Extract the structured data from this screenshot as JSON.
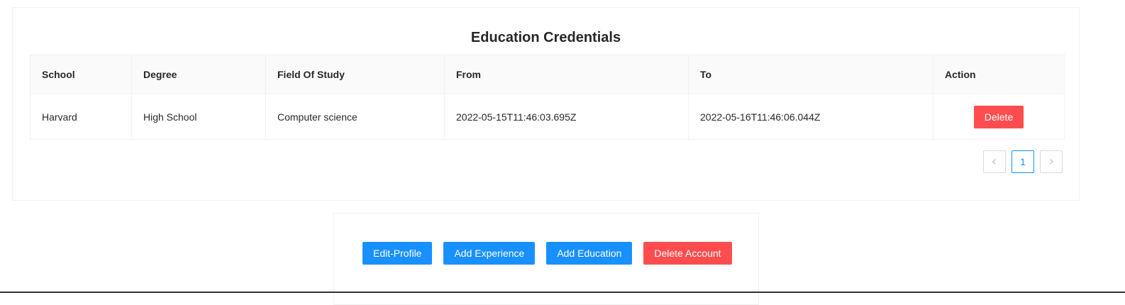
{
  "credentials_card": {
    "title": "Education Credentials",
    "columns": [
      "School",
      "Degree",
      "Field Of Study",
      "From",
      "To",
      "Action"
    ],
    "rows": [
      {
        "school": "Harvard",
        "degree": "High School",
        "field_of_study": "Computer science",
        "from": "2022-05-15T11:46:03.695Z",
        "to": "2022-05-16T11:46:06.044Z",
        "action_label": "Delete"
      }
    ],
    "pagination": {
      "prev_icon": "chevron-left-icon",
      "next_icon": "chevron-right-icon",
      "pages": [
        "1"
      ],
      "current_page": "1"
    }
  },
  "actions": {
    "edit_profile": "Edit-Profile",
    "add_experience": "Add Experience",
    "add_education": "Add Education",
    "delete_account": "Delete Account"
  },
  "colors": {
    "primary": "#1890ff",
    "danger": "#ff4d4f",
    "header_bg": "#fafafa",
    "border": "#f0f0f0"
  }
}
